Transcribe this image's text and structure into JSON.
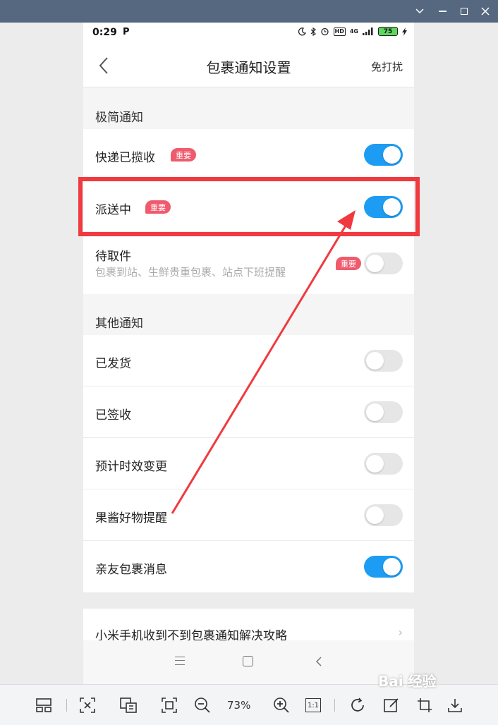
{
  "window": {
    "controls": [
      "chevron-down-icon",
      "minimize-icon",
      "maximize-icon",
      "close-icon"
    ]
  },
  "status_bar": {
    "time": "0:29",
    "network": "4G",
    "battery": "75"
  },
  "nav": {
    "title": "包裹通知设置",
    "right_action": "免打扰"
  },
  "sections": {
    "minimal": {
      "header": "极简通知",
      "items": [
        {
          "label": "快递已揽收",
          "badge": "重要",
          "enabled": true
        },
        {
          "label": "派送中",
          "badge": "重要",
          "enabled": true
        },
        {
          "label": "待取件",
          "subtitle": "包裹到站、生鲜贵重包裹、站点下班提醒",
          "badge": "重要",
          "enabled": false
        }
      ]
    },
    "other": {
      "header": "其他通知",
      "items": [
        {
          "label": "已发货",
          "enabled": false
        },
        {
          "label": "已签收",
          "enabled": false
        },
        {
          "label": "预计时效变更",
          "enabled": false
        },
        {
          "label": "果酱好物提醒",
          "enabled": false
        },
        {
          "label": "亲友包裹消息",
          "enabled": true
        }
      ]
    }
  },
  "help_link": "小米手机收到不到包裹通知解决攻略",
  "viewer": {
    "zoom": "73%",
    "actual_size": "1:1"
  },
  "watermark": "Bai 经验",
  "colors": {
    "accent": "#1c9cf3",
    "badge": "#f05a6d",
    "annotation": "#f03a3f",
    "titlebar": "#566780"
  }
}
